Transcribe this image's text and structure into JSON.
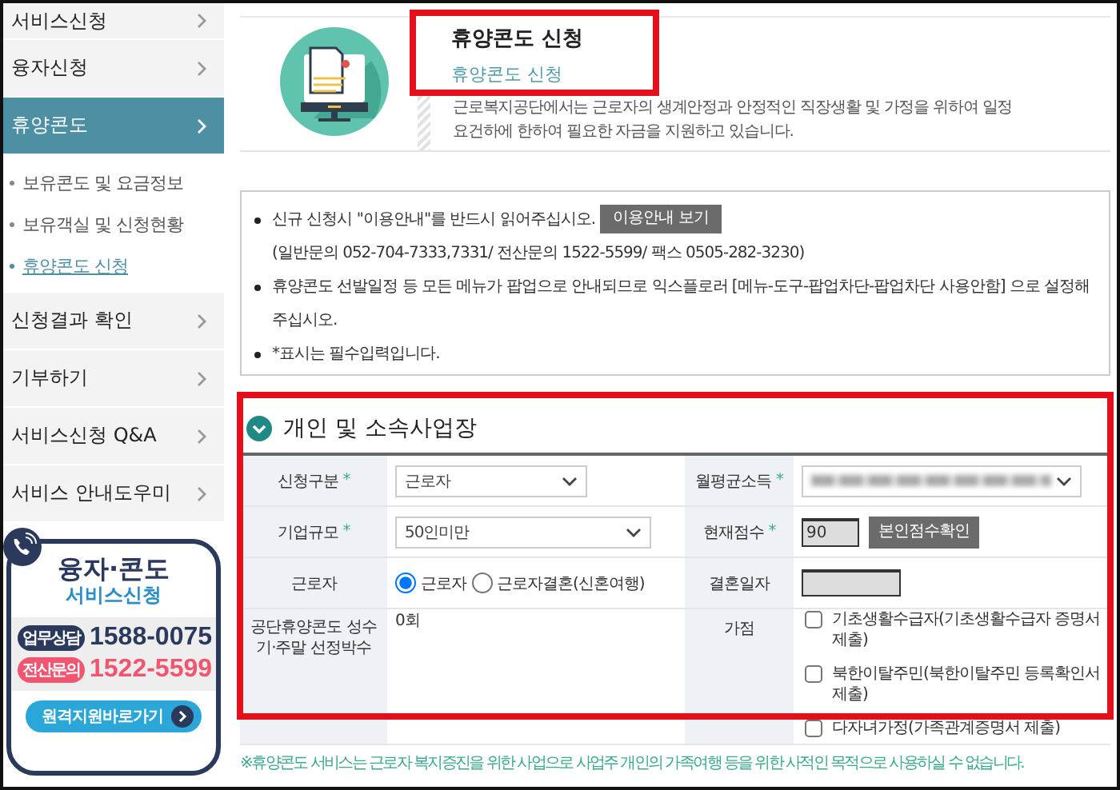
{
  "sidebar": {
    "items": [
      {
        "label": "서비스신청",
        "selected": false
      },
      {
        "label": "융자신청",
        "selected": false
      },
      {
        "label": "휴양콘도",
        "selected": true,
        "children": [
          {
            "label": "보유콘도 및 요금정보",
            "selected": false
          },
          {
            "label": "보유객실 및 신청현황",
            "selected": false
          },
          {
            "label": "휴양콘도 신청",
            "selected": true
          }
        ]
      },
      {
        "label": "신청결과 확인",
        "selected": false
      },
      {
        "label": "기부하기",
        "selected": false
      },
      {
        "label": "서비스신청 Q&A",
        "selected": false
      },
      {
        "label": "서비스 안내도우미",
        "selected": false
      }
    ]
  },
  "banner": {
    "title": "융자·콘도",
    "subtitle": "서비스신청",
    "contacts": [
      {
        "label": "업무상담",
        "number": "1588-0075",
        "color": "#2b3a5c"
      },
      {
        "label": "전산문의",
        "number": "1522-5599",
        "color": "#f0566f"
      }
    ],
    "button": "원격지원바로가기"
  },
  "header": {
    "title": "휴양콘도 신청",
    "breadcrumb": "휴양콘도 신청",
    "highlighted": true,
    "description": "근로복지공단에서는 근로자의 생계안정과 안정적인 직장생활 및 가정을 위하여 일정요건하에 한하여 필요한 자금을 지원하고 있습니다."
  },
  "notices": [
    {
      "text": "신규 신청시 \"이용안내\"를 반드시 읽어주십시오.",
      "button": "이용안내 보기",
      "note": "(일반문의 052-704-7333,7331/ 전산문의 1522-5599/ 팩스 0505-282-3230)"
    },
    {
      "text": "휴양콘도 선발일정 등 모든 메뉴가 팝업으로 안내되므로 익스플로러 [메뉴-도구-팝업차단-팝업차단 사용안함] 으로 설정해 주십시오."
    },
    {
      "text": "*표시는 필수입력입니다."
    }
  ],
  "form": {
    "title": "개인 및 소속사업장",
    "highlighted": true,
    "fields": [
      {
        "label": "신청구분",
        "required": true,
        "required_mark": "*",
        "kind": "select",
        "value": "근로자"
      },
      {
        "label": "월평균소득",
        "required": true,
        "required_mark": "*",
        "kind": "select"
      },
      {
        "label": "기업규모",
        "required": true,
        "required_mark": "*",
        "kind": "select",
        "value": "50인미만"
      },
      {
        "label": "현재점수",
        "required": true,
        "required_mark": "*",
        "kind": "score",
        "value": "90",
        "button": "본인점수확인"
      },
      {
        "label": "근로자",
        "required": false,
        "kind": "radio",
        "options": [
          {
            "label": "근로자",
            "selected": true
          },
          {
            "label": "근로자결혼(신혼여행)",
            "selected": false
          }
        ]
      },
      {
        "label": "결혼일자",
        "required": false,
        "kind": "input",
        "disabled": true
      },
      {
        "label": "공단휴양콘도 성수기·주말 선정박수",
        "required": false,
        "kind": "text",
        "value": "0회"
      },
      {
        "label": "가점",
        "required": false,
        "kind": "checkboxes",
        "options": [
          {
            "label": "기초생활수급자(기초생활수급자 증명서 제출)",
            "checked": false
          },
          {
            "label": "북한이탈주민(북한이탈주민 등록확인서 제출)",
            "checked": false
          },
          {
            "label": "다자녀가정(가족관계증명서 제출)",
            "checked": false
          }
        ]
      }
    ]
  },
  "footnote": "※휴양콘도 서비스는 근로자 복지증진을 위한 사업으로 사업주 개인의 가족여행 등을 위한 사적인 목적으로 사용하실 수 없습니다."
}
